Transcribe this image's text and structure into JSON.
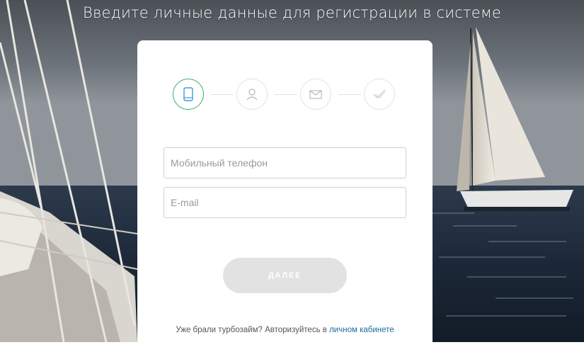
{
  "header": {
    "title": "Введите личные данные для регистрации в системе"
  },
  "steps": [
    {
      "icon": "phone-icon",
      "state": "active"
    },
    {
      "icon": "user-icon",
      "state": "inactive"
    },
    {
      "icon": "envelope-icon",
      "state": "inactive"
    },
    {
      "icon": "checkmark-icon",
      "state": "inactive"
    }
  ],
  "form": {
    "phone_placeholder": "Мобильный телефон",
    "phone_value": "",
    "email_placeholder": "E-mail",
    "email_value": "",
    "next_label": "ДАЛЕЕ"
  },
  "footer": {
    "prompt": "Уже брали турбозайм? Авторизуйтесь в",
    "link_label": "личном кабинете"
  },
  "colors": {
    "accent_green": "#3aac6e",
    "phone_icon": "#3a9ed4",
    "link": "#1a6ba0",
    "button_disabled": "#e2e2e2"
  }
}
